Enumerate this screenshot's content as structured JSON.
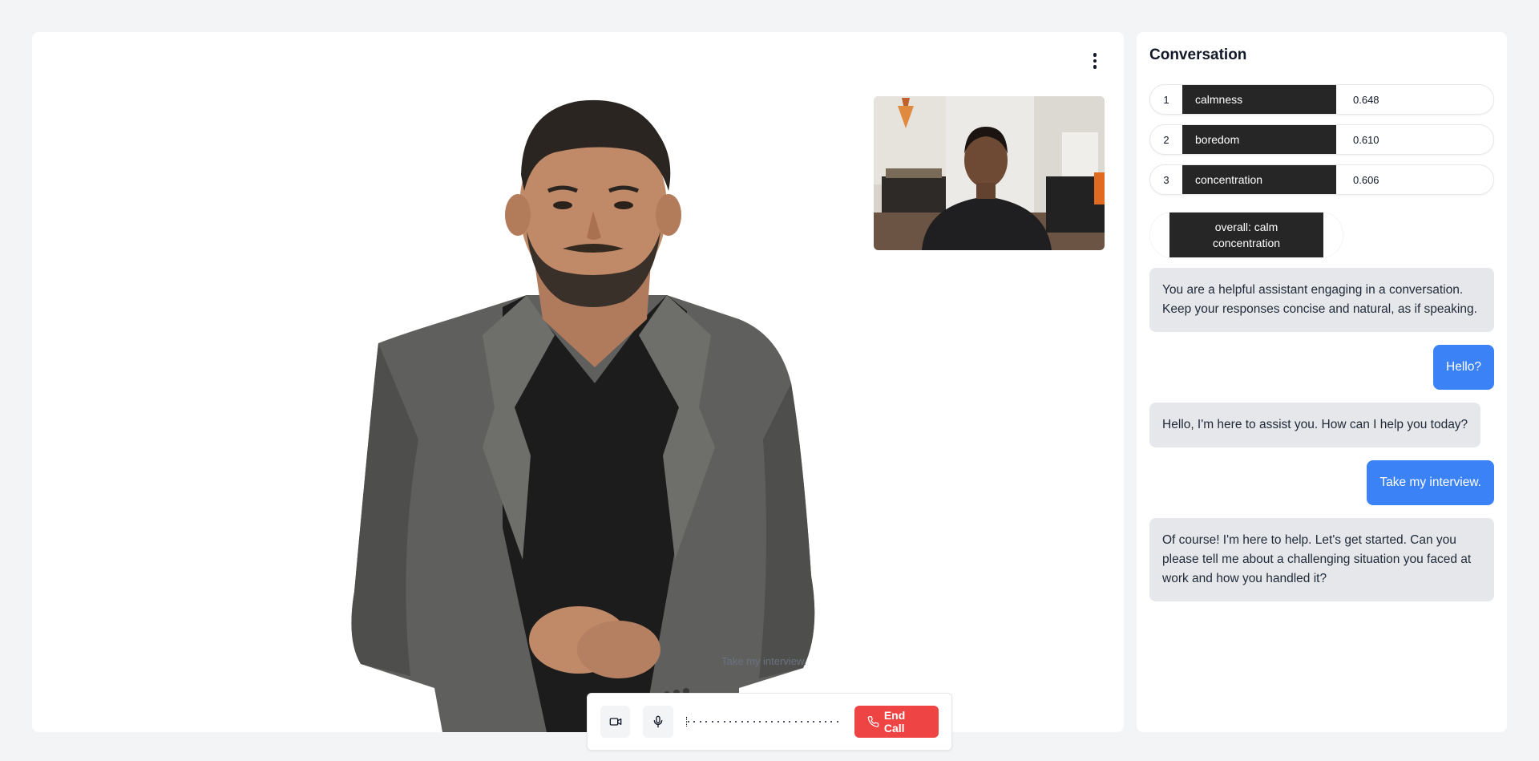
{
  "video": {
    "caption": "Take my interview.",
    "menu_icon": "more-vertical-icon"
  },
  "controls": {
    "camera_icon": "video-camera-icon",
    "mic_icon": "microphone-icon",
    "end_call_label": "End Call",
    "end_call_icon": "phone-icon",
    "end_call_color": "#ef4444"
  },
  "conversation": {
    "title": "Conversation",
    "emotions": [
      {
        "rank": "1",
        "label": "calmness",
        "score": "0.648"
      },
      {
        "rank": "2",
        "label": "boredom",
        "score": "0.610"
      },
      {
        "rank": "3",
        "label": "concentration",
        "score": "0.606"
      }
    ],
    "overall": "overall: calm concentration",
    "messages": [
      {
        "role": "assistant",
        "text": "You are a helpful assistant engaging in a conversation. Keep your responses concise and natural, as if speaking."
      },
      {
        "role": "user",
        "text": "Hello?"
      },
      {
        "role": "assistant",
        "text": "Hello, I'm here to assist you. How can I help you today?"
      },
      {
        "role": "user",
        "text": "Take my interview."
      },
      {
        "role": "assistant",
        "text": "Of course! I'm here to help. Let's get started. Can you please tell me about a challenging situation you faced at work and how you handled it?"
      }
    ],
    "user_bubble_color": "#3b82f6",
    "assistant_bubble_color": "#e5e7eb"
  }
}
